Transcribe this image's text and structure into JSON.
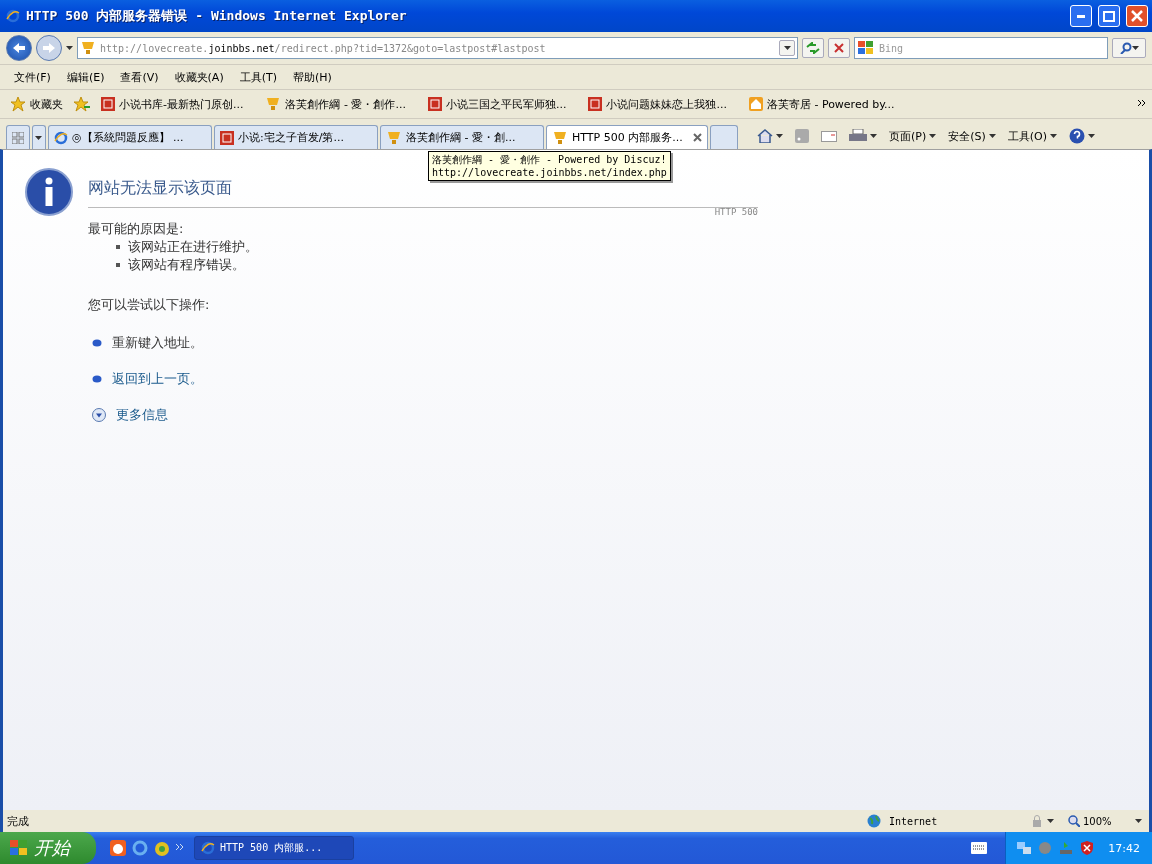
{
  "window": {
    "title": "HTTP 500 内部服务器错误 - Windows Internet Explorer"
  },
  "address_bar": {
    "url_parts": [
      {
        "text": "http://lovecreate.",
        "emphasized": false
      },
      {
        "text": "joinbbs.net",
        "emphasized": true
      },
      {
        "text": "/redirect.php?tid=1372&goto=lastpost#lastpost",
        "emphasized": false
      }
    ]
  },
  "search": {
    "placeholder": "Bing"
  },
  "menu": [
    "文件(F)",
    "编辑(E)",
    "查看(V)",
    "收藏夹(A)",
    "工具(T)",
    "帮助(H)"
  ],
  "favorites": {
    "label": "收藏夹",
    "links": [
      {
        "label": "小说书库-最新热门原创...",
        "kind": "seal"
      },
      {
        "label": "洛芙創作綱 - 愛・創作...",
        "kind": "trophy"
      },
      {
        "label": "小说三国之平民军师独...",
        "kind": "seal"
      },
      {
        "label": "小说问题妹妹恋上我独...",
        "kind": "seal"
      },
      {
        "label": "洛芙寄居 - Powered by...",
        "kind": "home"
      }
    ]
  },
  "tabs": [
    {
      "label": "◎【系統問題反應】 ...",
      "kind": "ie",
      "selected": false
    },
    {
      "label": "小说:宅之子首发/第...",
      "kind": "seal",
      "selected": false
    },
    {
      "label": "洛芙創作綱 - 愛・創...",
      "kind": "trophy",
      "selected": false
    },
    {
      "label": "HTTP 500 内部服务...",
      "kind": "trophy",
      "selected": true
    }
  ],
  "command_bar": [
    "页面(P)",
    "安全(S)",
    "工具(O)"
  ],
  "tooltip": {
    "lines": [
      "洛芙創作綱 - 愛・創作 - Powered by Discuz!",
      "http://lovecreate.joinbbs.net/index.php"
    ]
  },
  "error_page": {
    "title": "网站无法显示该页面",
    "code": "HTTP 500",
    "causes_heading": "最可能的原因是:",
    "causes": [
      "该网站正在进行维护。",
      "该网站有程序错误。"
    ],
    "actions_heading": "您可以尝试以下操作:",
    "actions": [
      {
        "label": "重新键入地址。",
        "kind": "text"
      },
      {
        "label": "返回到上一页。",
        "kind": "link"
      },
      {
        "label": "更多信息",
        "kind": "expander"
      }
    ]
  },
  "status_bar": {
    "text": "完成",
    "zone": "Internet",
    "zoom": "100%"
  },
  "taskbar": {
    "start": "开始",
    "tasks": [
      {
        "label": "HTTP 500 内部服...",
        "selected": true
      }
    ],
    "clock": "17:42"
  }
}
